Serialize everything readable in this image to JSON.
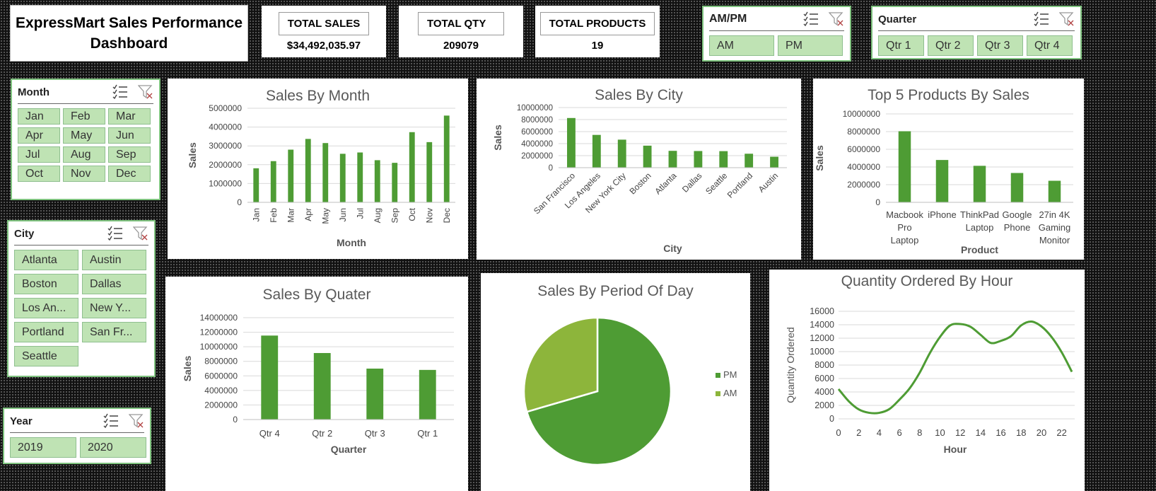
{
  "dashboard": {
    "title_line1": "ExpressMart Sales Performance",
    "title_line2": "Dashboard"
  },
  "kpis": [
    {
      "label": "TOTAL SALES",
      "value": "$34,492,035.97"
    },
    {
      "label": "TOTAL QTY",
      "value": "209079"
    },
    {
      "label": "TOTAL PRODUCTS",
      "value": "19"
    }
  ],
  "slicers": {
    "ampm": {
      "title": "AM/PM",
      "items": [
        "AM",
        "PM"
      ]
    },
    "quarter": {
      "title": "Quarter",
      "items": [
        "Qtr 1",
        "Qtr 2",
        "Qtr 3",
        "Qtr 4"
      ]
    },
    "month": {
      "title": "Month",
      "items": [
        "Jan",
        "Feb",
        "Mar",
        "Apr",
        "May",
        "Jun",
        "Jul",
        "Aug",
        "Sep",
        "Oct",
        "Nov",
        "Dec"
      ]
    },
    "city": {
      "title": "City",
      "items": [
        "Atlanta",
        "Austin",
        "Boston",
        "Dallas",
        "Los An...",
        "New Y...",
        "Portland",
        "San Fr...",
        "Seattle"
      ]
    },
    "year": {
      "title": "Year",
      "items": [
        "2019",
        "2020"
      ]
    }
  },
  "colors": {
    "bar": "#4e9c34",
    "pie_am": "#8db53b",
    "pie_pm": "#4e9c34",
    "slicer_fill": "#bfe3b4"
  },
  "icons": {
    "multiselect": "multi-select-icon",
    "clear_filter": "clear-filter-icon"
  },
  "chart_data": [
    {
      "id": "month",
      "type": "bar",
      "title": "Sales By Month",
      "xlabel": "Month",
      "ylabel": "Sales",
      "categories": [
        "Jan",
        "Feb",
        "Mar",
        "Apr",
        "May",
        "Jun",
        "Jul",
        "Aug",
        "Sep",
        "Oct",
        "Nov",
        "Dec"
      ],
      "values": [
        1810000,
        2190000,
        2800000,
        3370000,
        3150000,
        2580000,
        2650000,
        2240000,
        2100000,
        3730000,
        3200000,
        4610000
      ],
      "ylim": [
        0,
        5000000
      ],
      "yticks": [
        "0",
        "1000000",
        "2000000",
        "3000000",
        "4000000",
        "5000000"
      ]
    },
    {
      "id": "city",
      "type": "bar",
      "title": "Sales By City",
      "xlabel": "City",
      "ylabel": "Sales",
      "categories": [
        "San Francisco",
        "Los Angeles",
        "New York City",
        "Boston",
        "Atlanta",
        "Dallas",
        "Seattle",
        "Portland",
        "Austin"
      ],
      "values": [
        8260000,
        5450000,
        4660000,
        3660000,
        2800000,
        2770000,
        2750000,
        2320000,
        1820000
      ],
      "ylim": [
        0,
        10000000
      ],
      "yticks": [
        "0",
        "2000000",
        "4000000",
        "6000000",
        "8000000",
        "10000000"
      ]
    },
    {
      "id": "products",
      "type": "bar",
      "title": "Top 5 Products By Sales",
      "xlabel": "Product",
      "ylabel": "Sales",
      "categories": [
        "Macbook Pro Laptop",
        "iPhone",
        "ThinkPad Laptop",
        "Google Phone",
        "27in 4K Gaming Monitor"
      ],
      "category_lines": [
        [
          "Macbook",
          "Pro",
          "Laptop"
        ],
        [
          "iPhone"
        ],
        [
          "ThinkPad",
          "Laptop"
        ],
        [
          "Google",
          "Phone"
        ],
        [
          "27in 4K",
          "Gaming",
          "Monitor"
        ]
      ],
      "values": [
        8040000,
        4790000,
        4130000,
        3320000,
        2440000
      ],
      "ylim": [
        0,
        10000000
      ],
      "yticks": [
        "0",
        "2000000",
        "4000000",
        "6000000",
        "8000000",
        "10000000"
      ]
    },
    {
      "id": "quarter",
      "type": "bar",
      "title": "Sales By Quater",
      "xlabel": "Quarter",
      "ylabel": "Sales",
      "categories": [
        "Qtr 4",
        "Qtr 2",
        "Qtr 3",
        "Qtr 1"
      ],
      "values": [
        11540000,
        9140000,
        7000000,
        6820000
      ],
      "ylim": [
        0,
        14000000
      ],
      "yticks": [
        "0",
        "2000000",
        "4000000",
        "6000000",
        "8000000",
        "10000000",
        "12000000",
        "14000000"
      ]
    },
    {
      "id": "period",
      "type": "pie",
      "title": "Sales By Period Of Day",
      "categories": [
        "PM",
        "AM"
      ],
      "values": [
        70.5,
        29.5
      ],
      "legend": "right"
    },
    {
      "id": "hour",
      "type": "line",
      "title": "Quantity Ordered By Hour",
      "xlabel": "Hour",
      "ylabel": "Quantity Ordered",
      "x": [
        0,
        1,
        2,
        3,
        4,
        5,
        6,
        7,
        8,
        9,
        10,
        11,
        12,
        13,
        14,
        15,
        16,
        17,
        18,
        19,
        20,
        21,
        22,
        23
      ],
      "values": [
        4430,
        2630,
        1400,
        900,
        890,
        1440,
        2850,
        4520,
        6870,
        9780,
        12180,
        13900,
        14100,
        13700,
        12500,
        11300,
        11600,
        12300,
        13900,
        14470,
        13750,
        12180,
        9900,
        7000
      ],
      "ylim": [
        0,
        16000
      ],
      "yticks": [
        "0",
        "2000",
        "4000",
        "6000",
        "8000",
        "10000",
        "12000",
        "14000",
        "16000"
      ],
      "xticks": [
        "0",
        "2",
        "4",
        "6",
        "8",
        "10",
        "12",
        "14",
        "16",
        "18",
        "20",
        "22"
      ]
    }
  ]
}
